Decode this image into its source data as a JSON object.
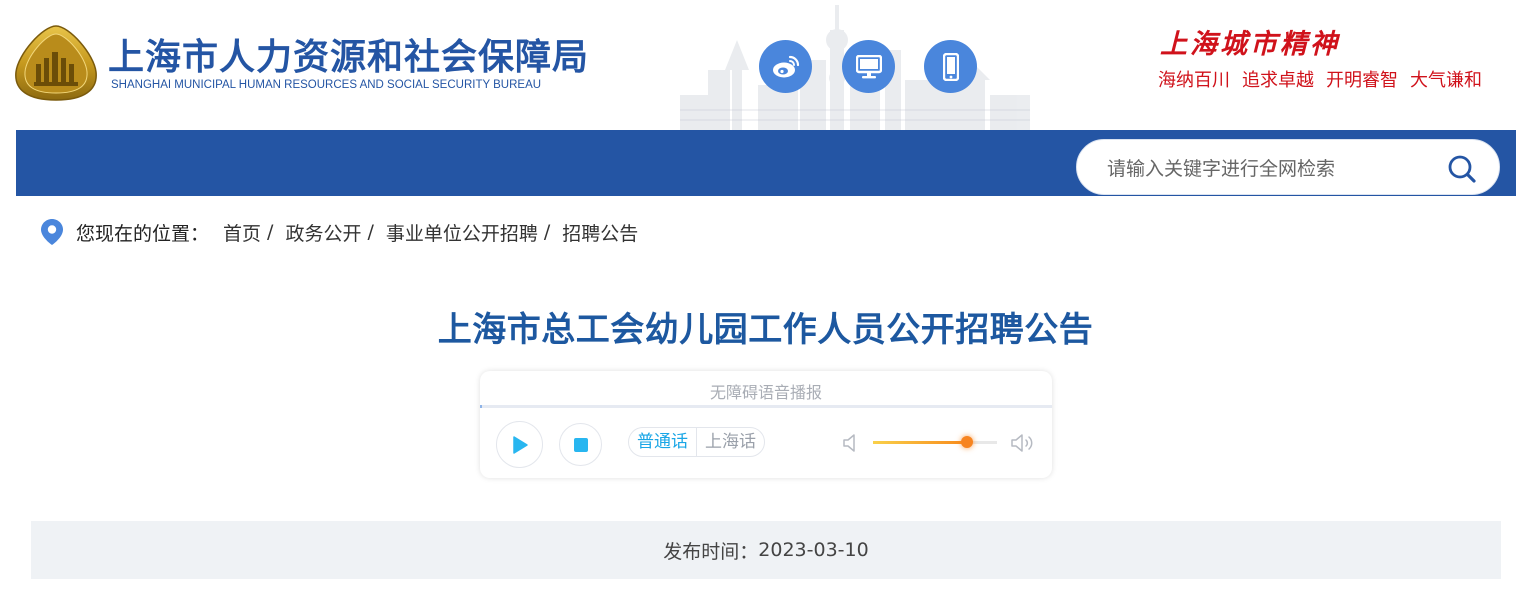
{
  "header": {
    "org_name_cn": "上海市人力资源和社会保障局",
    "org_name_en": "SHANGHAI MUNICIPAL HUMAN RESOURCES AND SOCIAL SECURITY BUREAU",
    "social_icons": [
      "weibo-icon",
      "desktop-icon",
      "mobile-icon"
    ],
    "slogan_title": "上海城市精神",
    "slogan_items": [
      "海纳百川",
      "追求卓越",
      "开明睿智",
      "大气谦和"
    ]
  },
  "nav": {
    "search_placeholder": "请输入关键字进行全网检索"
  },
  "breadcrumb": {
    "label": "您现在的位置：",
    "items": [
      "首页",
      "政务公开",
      "事业单位公开招聘",
      "招聘公告"
    ],
    "separator": "/"
  },
  "article": {
    "title": "上海市总工会幼儿园工作人员公开招聘公告",
    "publish_label": "发布时间：",
    "publish_date": "2023-03-10"
  },
  "player": {
    "title": "无障碍语音播报",
    "dialects": [
      "普通话",
      "上海话"
    ],
    "active_dialect": "普通话",
    "progress": 0.0,
    "volume": 0.76
  },
  "colors": {
    "brand_blue": "#2455a4",
    "title_blue": "#1d58a0",
    "slogan_red": "#d0121b",
    "accent_cyan": "#28b6f0",
    "volume_orange": "#f78420"
  }
}
